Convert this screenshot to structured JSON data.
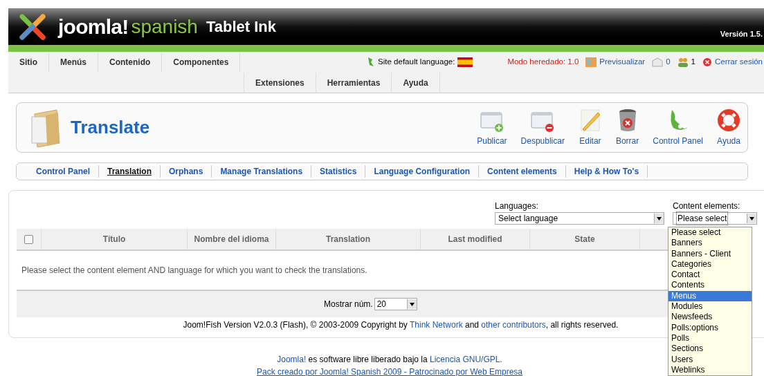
{
  "header": {
    "logo_word": "joomla!",
    "logo_sub": "spanish",
    "site_name": "Tablet Ink",
    "version": "Versión 1.5."
  },
  "menu": {
    "items": [
      {
        "label": "Sitio"
      },
      {
        "label": "Menús"
      },
      {
        "label": "Contenido"
      },
      {
        "label": "Componentes"
      }
    ],
    "items_row2": [
      {
        "label": "Extensiones"
      },
      {
        "label": "Herramientas"
      },
      {
        "label": "Ayuda"
      }
    ],
    "site_language": "Site default language:",
    "legacy": "Modo heredado: 1.0",
    "preview": "Previsualizar",
    "messages": "0",
    "users": "1",
    "logout": "Cerrar sesión"
  },
  "toolbar": {
    "title": "Translate",
    "buttons": [
      {
        "label": "Publicar",
        "kind": "publish"
      },
      {
        "label": "Despublicar",
        "kind": "unpublish"
      },
      {
        "label": "Editar",
        "kind": "edit"
      },
      {
        "label": "Borrar",
        "kind": "delete"
      },
      {
        "label": "Control Panel",
        "kind": "panel"
      },
      {
        "label": "Ayuda",
        "kind": "help"
      }
    ]
  },
  "submenu": [
    {
      "label": "Control Panel",
      "selected": false
    },
    {
      "label": "Translation",
      "selected": true
    },
    {
      "label": "Orphans",
      "selected": false
    },
    {
      "label": "Manage Translations",
      "selected": false
    },
    {
      "label": "Statistics",
      "selected": false
    },
    {
      "label": "Language Configuration",
      "selected": false
    },
    {
      "label": "Content elements",
      "selected": false
    },
    {
      "label": "Help & How To's",
      "selected": false
    }
  ],
  "filters": {
    "languages_label": "Languages:",
    "languages_value": "Select language",
    "elements_label": "Content elements:",
    "elements_value": "Please select"
  },
  "table": {
    "columns": [
      "Título",
      "Nombre del idioma",
      "Translation",
      "Last modified",
      "State"
    ],
    "select_all_checked": false,
    "message": "Please select the content element AND language for which you want to check the translations.",
    "show_label": "Mostrar núm.",
    "show_value": "20"
  },
  "credits": [
    {
      "text": "Joom!Fish Version V2.0.3 (Flash), © 2003-2009 Copyright by ",
      "link": false
    },
    {
      "text": "Think Network",
      "link": true
    },
    {
      "text": " and ",
      "link": false
    },
    {
      "text": "other contributors",
      "link": true
    },
    {
      "text": ", all rights reserved.",
      "link": false
    }
  ],
  "footer_line1": [
    {
      "text": "Joomla!",
      "link": true
    },
    {
      "text": " es software libre liberado bajo la ",
      "link": false
    },
    {
      "text": "Licencia GNU/GPL.",
      "link": true
    }
  ],
  "footer_line2": "Pack creado por Joomla! Spanish 2009 - Patrocinado por Web Empresa",
  "dropdown": {
    "options": [
      {
        "label": "Please select",
        "selected": false
      },
      {
        "label": "Banners",
        "selected": false
      },
      {
        "label": "Banners - Client",
        "selected": false
      },
      {
        "label": "Categories",
        "selected": false
      },
      {
        "label": "Contact",
        "selected": false
      },
      {
        "label": "Contents",
        "selected": false
      },
      {
        "label": "Menus",
        "selected": true
      },
      {
        "label": "Modules",
        "selected": false
      },
      {
        "label": "Newsfeeds",
        "selected": false
      },
      {
        "label": "Polls:options",
        "selected": false
      },
      {
        "label": "Polls",
        "selected": false
      },
      {
        "label": "Sections",
        "selected": false
      },
      {
        "label": "Users",
        "selected": false
      },
      {
        "label": "Weblinks",
        "selected": false
      }
    ]
  }
}
